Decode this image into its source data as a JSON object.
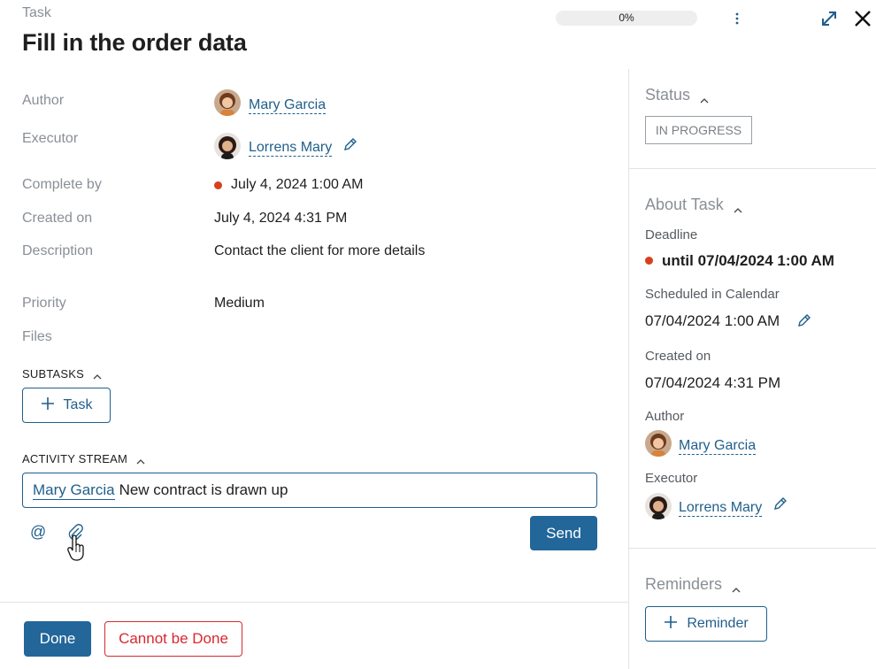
{
  "header": {
    "kind": "Task",
    "title": "Fill in the order data",
    "progress_text": "0%",
    "progress": 0
  },
  "details": {
    "author_label": "Author",
    "author_name": "Mary Garcia",
    "executor_label": "Executor",
    "executor_name": "Lorrens Mary",
    "complete_by_label": "Complete by",
    "complete_by_value": "July 4, 2024 1:00 AM",
    "created_on_label": "Created on",
    "created_on_value": "July 4, 2024 4:31 PM",
    "description_label": "Description",
    "description_value": "Contact the client for more details",
    "priority_label": "Priority",
    "priority_value": "Medium",
    "files_label": "Files"
  },
  "subtasks": {
    "heading": "SUBTASKS",
    "add_label": "Task"
  },
  "activity": {
    "heading": "ACTIVITY STREAM",
    "mention": "Mary Garcia",
    "comment_text": "New contract is drawn up",
    "send_label": "Send"
  },
  "footer": {
    "done_label": "Done",
    "cannot_label": "Cannot be Done"
  },
  "right": {
    "status_heading": "Status",
    "status_value": "IN PROGRESS",
    "about_heading": "About Task",
    "deadline_label": "Deadline",
    "deadline_value": "until 07/04/2024 1:00 AM",
    "scheduled_label": "Scheduled in Calendar",
    "scheduled_value": "07/04/2024 1:00 AM",
    "created_label": "Created on",
    "created_value": "07/04/2024 4:31 PM",
    "author_label": "Author",
    "author_name": "Mary Garcia",
    "executor_label": "Executor",
    "executor_name": "Lorrens Mary",
    "reminders_heading": "Reminders",
    "reminder_button": "Reminder"
  },
  "colors": {
    "accent": "#22669a",
    "link": "#1f5f8b",
    "overdue": "#d6401f",
    "danger": "#d9282f"
  },
  "icons": [
    "more-icon",
    "expand-icon",
    "close-icon",
    "pencil-icon",
    "chevron-up-icon",
    "plus-icon",
    "at-icon",
    "paperclip-icon",
    "cursor-hand-icon"
  ]
}
